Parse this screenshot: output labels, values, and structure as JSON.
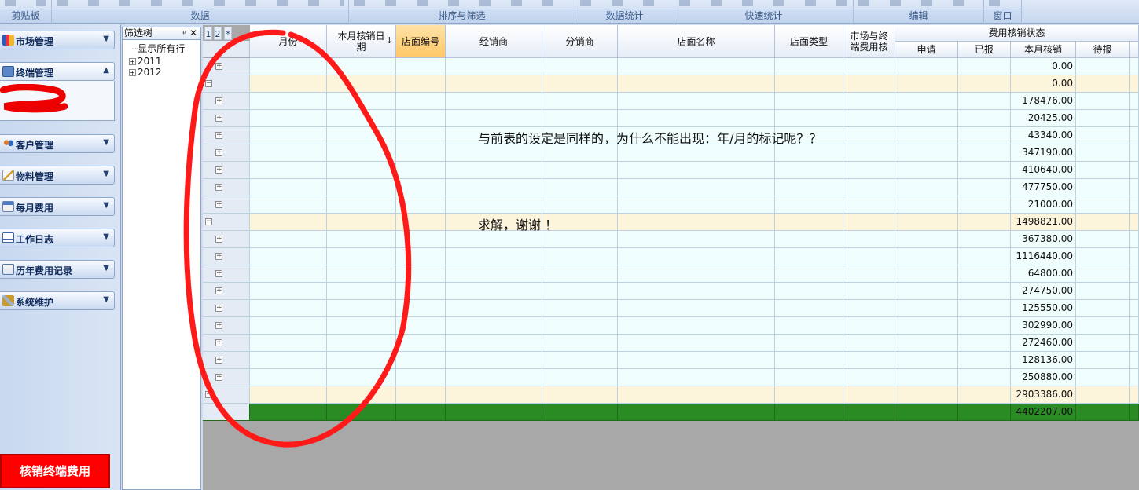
{
  "ribbon": {
    "groups": [
      {
        "label": "剪贴板"
      },
      {
        "label": "数据"
      },
      {
        "label": "排序与筛选"
      },
      {
        "label": "数据统计"
      },
      {
        "label": "快速统计"
      },
      {
        "label": "编辑"
      },
      {
        "label": "窗口"
      }
    ]
  },
  "nav": {
    "items": [
      {
        "label": "市场管理",
        "icon": "bar-chart-icon"
      },
      {
        "label": "终端管理",
        "icon": "terminal-list-icon"
      },
      {
        "label": "客户管理",
        "icon": "users-icon"
      },
      {
        "label": "物料管理",
        "icon": "box-edit-icon"
      },
      {
        "label": "每月费用",
        "icon": "calendar-icon"
      },
      {
        "label": "工作日志",
        "icon": "log-icon"
      },
      {
        "label": "历年费用记录",
        "icon": "history-icon"
      },
      {
        "label": "系统维护",
        "icon": "tools-icon"
      }
    ],
    "action_button": "核销终端费用"
  },
  "tree": {
    "title": "筛选树",
    "pin": "ᵖ",
    "close": "✕",
    "show_all": "显示所有行",
    "nodes": [
      "2011",
      "2012"
    ]
  },
  "grid": {
    "levels": [
      "1",
      "2",
      "*"
    ],
    "columns": {
      "month": "月份",
      "verify_date": "本月核销日期",
      "store_no": "店面编号",
      "dealer": "经销商",
      "distributor": "分销商",
      "store_name": "店面名称",
      "store_type": "店面类型",
      "market_fee": "市场与终端费用核",
      "status_group": "费用核销状态",
      "apply": "申请",
      "reported": "已报",
      "verified": "本月核销",
      "pending": "待报"
    },
    "sort_arrow": "↓",
    "rows": [
      {
        "type": "detail",
        "value": "0.00"
      },
      {
        "type": "group",
        "value": "0.00"
      },
      {
        "type": "detail",
        "value": "178476.00"
      },
      {
        "type": "detail",
        "value": "20425.00"
      },
      {
        "type": "detail",
        "value": "43340.00"
      },
      {
        "type": "detail",
        "value": "347190.00"
      },
      {
        "type": "detail",
        "value": "410640.00"
      },
      {
        "type": "detail",
        "value": "477750.00"
      },
      {
        "type": "detail",
        "value": "21000.00"
      },
      {
        "type": "group",
        "value": "1498821.00"
      },
      {
        "type": "detail",
        "value": "367380.00"
      },
      {
        "type": "detail",
        "value": "1116440.00"
      },
      {
        "type": "detail",
        "value": "64800.00"
      },
      {
        "type": "detail",
        "value": "274750.00"
      },
      {
        "type": "detail",
        "value": "125550.00"
      },
      {
        "type": "detail",
        "value": "302990.00"
      },
      {
        "type": "detail",
        "value": "272460.00"
      },
      {
        "type": "detail",
        "value": "128136.00"
      },
      {
        "type": "detail",
        "value": "250880.00"
      },
      {
        "type": "group",
        "value": "2903386.00"
      },
      {
        "type": "total",
        "value": "4402207.00"
      }
    ]
  },
  "annotations": {
    "question": "与前表的设定是同样的，为什么不能出现：年/月的标记呢？？",
    "thanks": "求解，谢谢 ！"
  },
  "colors": {
    "total_row": "#2a8a24",
    "group_row": "#fdf4dc",
    "detail_row": "#f0fdfd",
    "annotation_circle": "#ff1a1a",
    "action_button": "#ff0000"
  }
}
